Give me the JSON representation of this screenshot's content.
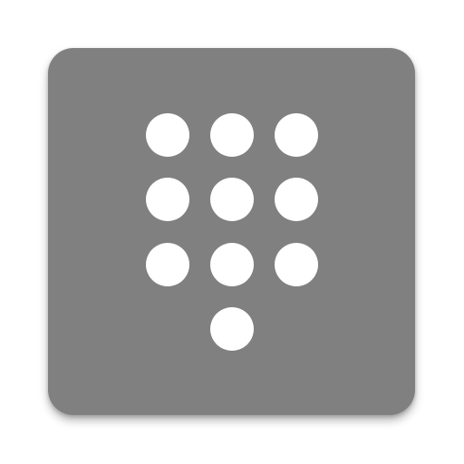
{
  "app_icon": {
    "name": "dialpad-icon",
    "background_color": "#808080",
    "dot_color": "#ffffff",
    "dots": [
      {
        "row": 1,
        "col": 1
      },
      {
        "row": 1,
        "col": 2
      },
      {
        "row": 1,
        "col": 3
      },
      {
        "row": 2,
        "col": 1
      },
      {
        "row": 2,
        "col": 2
      },
      {
        "row": 2,
        "col": 3
      },
      {
        "row": 3,
        "col": 1
      },
      {
        "row": 3,
        "col": 2
      },
      {
        "row": 3,
        "col": 3
      },
      {
        "row": 4,
        "col": 2
      }
    ]
  }
}
